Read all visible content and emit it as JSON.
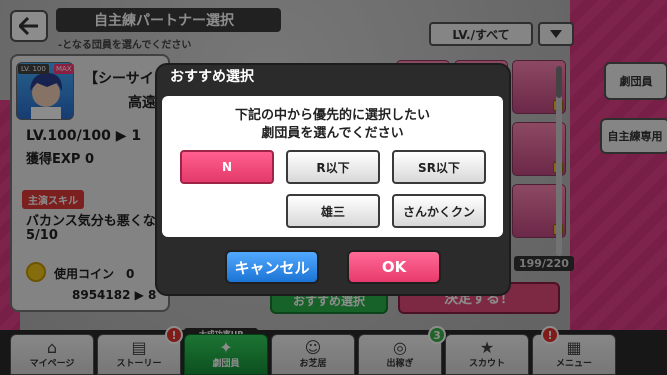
{
  "header": {
    "title": "自主練パートナー選択",
    "subtitle": "-となる団員を選んでください",
    "filter_label": "LV./すべて",
    "back_icon": "back-arrow-icon",
    "dropdown_icon": "chevron-down-icon"
  },
  "partner": {
    "lv_badge": "LV. 100",
    "max_badge": "MAX",
    "name_line1": "【シーサイド",
    "name_line2": "高遠",
    "level_text": "LV.100/100 ▶ 1",
    "exp_text": "獲得EXP 0",
    "skill_badge": "主演スキル",
    "skill_name": "バカンス気分も悪くな",
    "skill_count": "5/10",
    "coin_label": "使用コイン　0",
    "coin_total": "8954182 ▶ 8"
  },
  "list": {
    "count": "199/220",
    "side_btn_1": "劇団員",
    "side_btn_2": "自主練専用",
    "green_btn": "おすすめ選択",
    "red_btn": "決定する！"
  },
  "modal": {
    "title": "おすすめ選択",
    "message_line1": "下記の中から優先的に選択したい",
    "message_line2": "劇団員を選んでください",
    "options": [
      {
        "label": "N",
        "selected": true
      },
      {
        "label": "R以下",
        "selected": false
      },
      {
        "label": "SR以下",
        "selected": false
      },
      {
        "label": "雄三",
        "selected": false
      },
      {
        "label": "さんかくクン",
        "selected": false
      }
    ],
    "cancel": "キャンセル",
    "ok": "OK"
  },
  "nav": {
    "banner": "大成功率UP",
    "items": [
      {
        "label": "マイページ",
        "icon": "home-icon"
      },
      {
        "label": "ストーリー",
        "icon": "book-icon",
        "badge": "!"
      },
      {
        "label": "劇団員",
        "icon": "troupe-icon",
        "active": true
      },
      {
        "label": "お芝居",
        "icon": "theater-icon"
      },
      {
        "label": "出稼ぎ",
        "icon": "coins-icon",
        "badge": "3"
      },
      {
        "label": "スカウト",
        "icon": "scout-icon",
        "badge": "!"
      },
      {
        "label": "メニュー",
        "icon": "menu-grid-icon"
      }
    ]
  },
  "colors": {
    "accent_pink": "#e33a6a",
    "accent_blue": "#1b74d4",
    "nav_active_green": "#17933a"
  }
}
